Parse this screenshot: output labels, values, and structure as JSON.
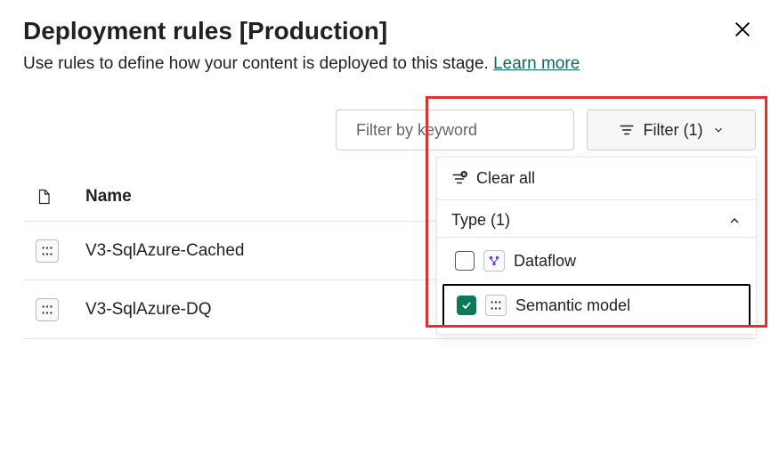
{
  "header": {
    "title": "Deployment rules [Production]",
    "subtitle": "Use rules to define how your content is deployed to this stage. ",
    "learn_more": "Learn more"
  },
  "toolbar": {
    "search_placeholder": "Filter by keyword",
    "filter_label": "Filter (1)",
    "filter_count": 1
  },
  "table": {
    "columns": [
      "Name"
    ],
    "rows": [
      {
        "name": "V3-SqlAzure-Cached",
        "type": "Semantic model"
      },
      {
        "name": "V3-SqlAzure-DQ",
        "type": "Semantic model"
      }
    ]
  },
  "filter_panel": {
    "clear_label": "Clear all",
    "group_label": "Type (1)",
    "group_count": 1,
    "options": [
      {
        "label": "Dataflow",
        "checked": false,
        "icon": "dataflow-icon"
      },
      {
        "label": "Semantic model",
        "checked": true,
        "icon": "semantic-model-icon"
      }
    ]
  },
  "colors": {
    "accent_link": "#0b6a5d",
    "checkbox_checked": "#0b7a5a",
    "annotation_box": "#e03030"
  }
}
